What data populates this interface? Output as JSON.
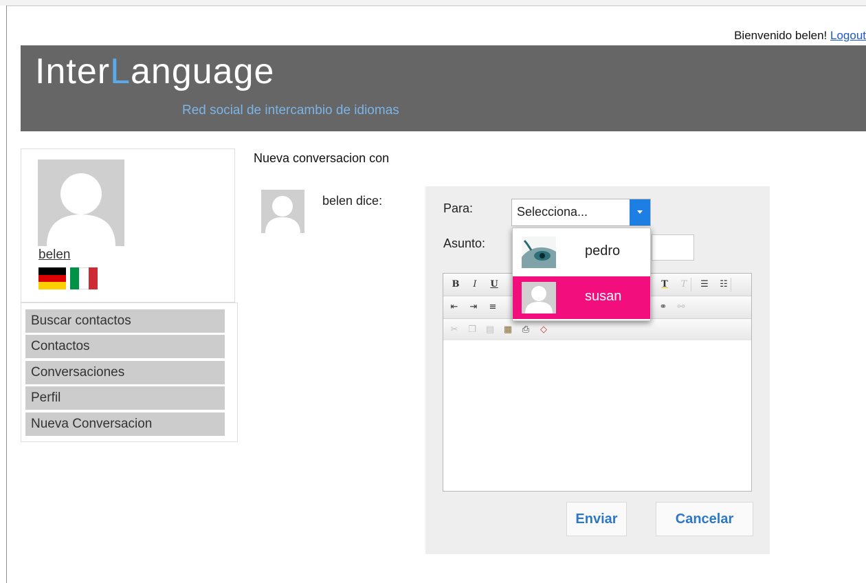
{
  "header": {
    "welcome_text": "Bienvenido belen!",
    "logout_label": "Logout",
    "logo_part1": "Inter",
    "logo_accent": "L",
    "logo_part2": "anguage",
    "tagline": "Red social de intercambio de idiomas"
  },
  "profile": {
    "username": "belen",
    "flags": [
      "german-flag-icon",
      "italian-flag-icon"
    ]
  },
  "menu": {
    "items": [
      {
        "label": "Buscar contactos"
      },
      {
        "label": "Contactos"
      },
      {
        "label": "Conversaciones"
      },
      {
        "label": "Perfil"
      },
      {
        "label": "Nueva Conversacion"
      }
    ]
  },
  "conversation": {
    "title": "Nueva conversacion con",
    "author_says": "belen dice:",
    "to_label": "Para:",
    "to_placeholder": "Selecciona...",
    "subject_label": "Asunto:",
    "send_label": "Enviar",
    "cancel_label": "Cancelar"
  },
  "dropdown": {
    "options": [
      {
        "name": "pedro",
        "selected": false
      },
      {
        "name": "susan",
        "selected": true
      }
    ]
  },
  "toolbar": {
    "row1": [
      "bold-icon",
      "italic-icon",
      "underline-icon",
      "strikethrough-icon",
      "highlight-icon",
      "remove-format-icon",
      "bulleted-list-icon",
      "numbered-list-icon"
    ],
    "row2": [
      "outdent-icon",
      "indent-icon",
      "align-left-icon",
      "link-icon",
      "unlink-icon"
    ],
    "row3": [
      "cut-icon",
      "copy-icon",
      "paste-icon",
      "paste-text-icon",
      "print-icon",
      "source-icon"
    ]
  },
  "colors": {
    "banner": "#666666",
    "logo_accent": "#5aa9ea",
    "selected_option": "#f20e7c",
    "select_button": "#1d7fe3",
    "button_text": "#2d77c9"
  }
}
